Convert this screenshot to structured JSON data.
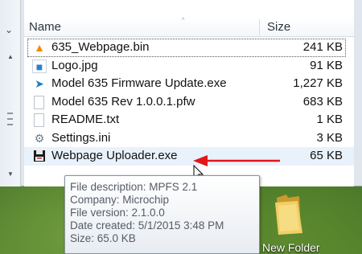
{
  "header": {
    "name_label": "Name",
    "size_label": "Size"
  },
  "files": [
    {
      "name": "635_Webpage.bin",
      "size": "241 KB",
      "icon": "vlc-cone-icon"
    },
    {
      "name": "Logo.jpg",
      "size": "91 KB",
      "icon": "image-file-icon"
    },
    {
      "name": "Model 635 Firmware Update.exe",
      "size": "1,227 KB",
      "icon": "installer-icon"
    },
    {
      "name": "Model 635 Rev 1.0.0.1.pfw",
      "size": "683 KB",
      "icon": "blank-file-icon"
    },
    {
      "name": "README.txt",
      "size": "1 KB",
      "icon": "text-file-icon"
    },
    {
      "name": "Settings.ini",
      "size": "3 KB",
      "icon": "settings-file-icon"
    },
    {
      "name": "Webpage Uploader.exe",
      "size": "65 KB",
      "icon": "floppy-app-icon"
    }
  ],
  "tooltip": {
    "description": "File description: MPFS 2.1",
    "company": "Company: Microchip",
    "version": "File version: 2.1.0.0",
    "date_created": "Date created: 5/1/2015 3:48 PM",
    "size": "Size: 65.0 KB"
  },
  "desktop": {
    "folder_label": "New Folder"
  },
  "colors": {
    "annotation_arrow": "#e0161b",
    "hover_row": "#e9f2fb",
    "folder": "#e8c45a"
  }
}
